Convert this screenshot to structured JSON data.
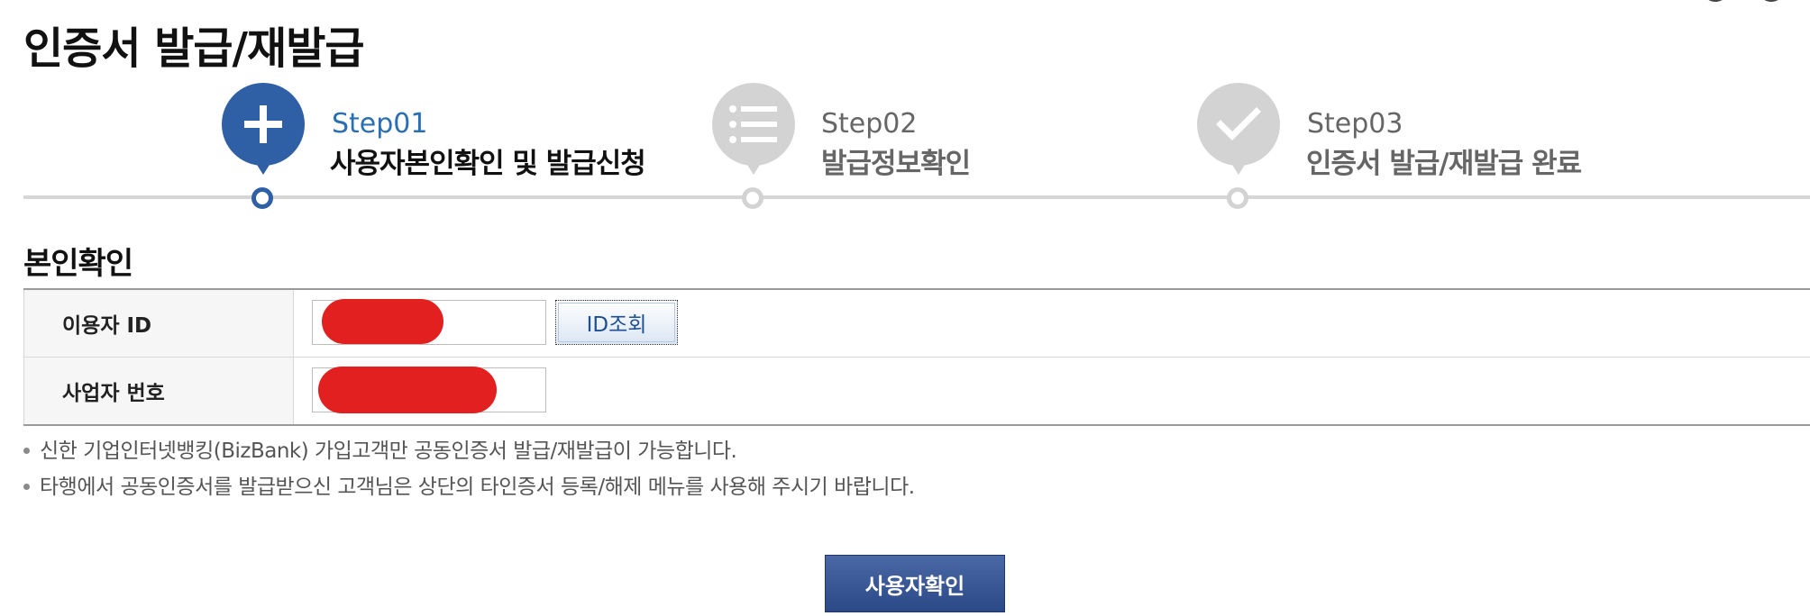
{
  "page": {
    "title": "인증서 발급/재발급"
  },
  "steps": [
    {
      "number": "Step01",
      "title": "사용자본인확인 및 발급신청",
      "icon": "plus-icon",
      "state": "active"
    },
    {
      "number": "Step02",
      "title": "발급정보확인",
      "icon": "list-icon",
      "state": "inactive"
    },
    {
      "number": "Step03",
      "title": "인증서 발급/재발급 완료",
      "icon": "check-icon",
      "state": "inactive"
    }
  ],
  "section": {
    "title": "본인확인"
  },
  "form": {
    "user_id": {
      "label": "이용자 ID",
      "value": "",
      "lookup_button": "ID조회"
    },
    "business_number": {
      "label": "사업자 번호",
      "value": ""
    }
  },
  "notices": [
    "신한 기업인터넷뱅킹(BizBank) 가입고객만 공동인증서 발급/재발급이 가능합니다.",
    "타행에서 공동인증서를 발급받으신 고객님은 상단의 타인증서 등록/해제 메뉴를 사용해 주시기 바랍니다."
  ],
  "actions": {
    "confirm_label": "사용자확인"
  },
  "colors": {
    "accent": "#2f5fa5",
    "step_active_text": "#2a6fb3",
    "step_inactive": "#d3d3d3",
    "redaction": "#e32020",
    "confirm_button": "#3a5896"
  }
}
